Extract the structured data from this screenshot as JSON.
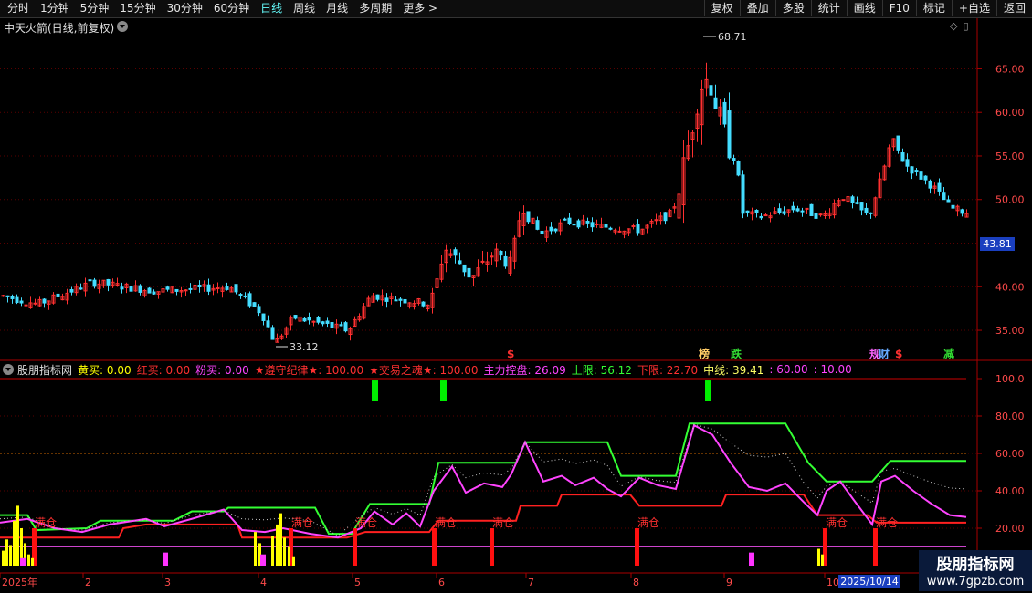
{
  "toolbar": {
    "periods": [
      "分时",
      "1分钟",
      "5分钟",
      "15分钟",
      "30分钟",
      "60分钟",
      "日线",
      "周线",
      "月线",
      "多周期",
      "更多"
    ],
    "more_arrow": ">",
    "right_buttons": [
      "复权",
      "叠加",
      "多股",
      "统计",
      "画线",
      "F10",
      "标记",
      "+自选",
      "返回"
    ]
  },
  "main_chart": {
    "title": "中天火箭(日线,前复权)",
    "y_ticks": [
      "65.00",
      "60.00",
      "55.00",
      "50.00",
      "40.00",
      "35.00"
    ],
    "high_label": "68.71",
    "low_label": "33.12",
    "current_price": "43.81",
    "markers": [
      {
        "text": "$",
        "color": "#ff3030"
      },
      {
        "text": "榜",
        "color": "#ffcc66"
      },
      {
        "text": "跌",
        "color": "#33dd33"
      },
      {
        "text": "规",
        "color": "#ff66ff"
      },
      {
        "text": "财",
        "color": "#66aaff"
      },
      {
        "text": "$",
        "color": "#ff3030"
      },
      {
        "text": "减",
        "color": "#33dd33"
      }
    ]
  },
  "indicator": {
    "name": "股朋指标网",
    "fields": [
      {
        "label": "黄买: 0.00",
        "color": "#ffff00"
      },
      {
        "label": "红买: 0.00",
        "color": "#ff3030"
      },
      {
        "label": "粉买: 0.00",
        "color": "#ff44ff"
      },
      {
        "label": "★遵守纪律★: 100.00",
        "color": "#ff3030"
      },
      {
        "label": "★交易之魂★: 100.00",
        "color": "#ff3030"
      },
      {
        "label": "主力控盘: 26.09",
        "color": "#ff44ff"
      },
      {
        "label": "上限: 56.12",
        "color": "#33ff33"
      },
      {
        "label": "下限: 22.70",
        "color": "#ff3030"
      },
      {
        "label": "中线: 39.41",
        "color": "#ffff66"
      },
      {
        "label": ": 60.00",
        "color": "#ff44ff"
      },
      {
        "label": ": 10.00",
        "color": "#ff44ff"
      }
    ],
    "y_ticks": [
      "100.0",
      "80.00",
      "60.00",
      "40.00",
      "20.00"
    ],
    "full_label": "满仓"
  },
  "x_axis": {
    "labels": [
      "2025年",
      "2",
      "3",
      "4",
      "5",
      "6",
      "7",
      "8",
      "9",
      "10"
    ],
    "cursor_date": "2025/10/14"
  },
  "watermark": {
    "line1": "股朋指标网",
    "line2": "www.7gpzb.com"
  },
  "colors": {
    "up": "#ff3030",
    "down": "#44ddff",
    "upper": "#33ff33",
    "lower": "#ff2020",
    "main": "#ff44ff"
  }
}
